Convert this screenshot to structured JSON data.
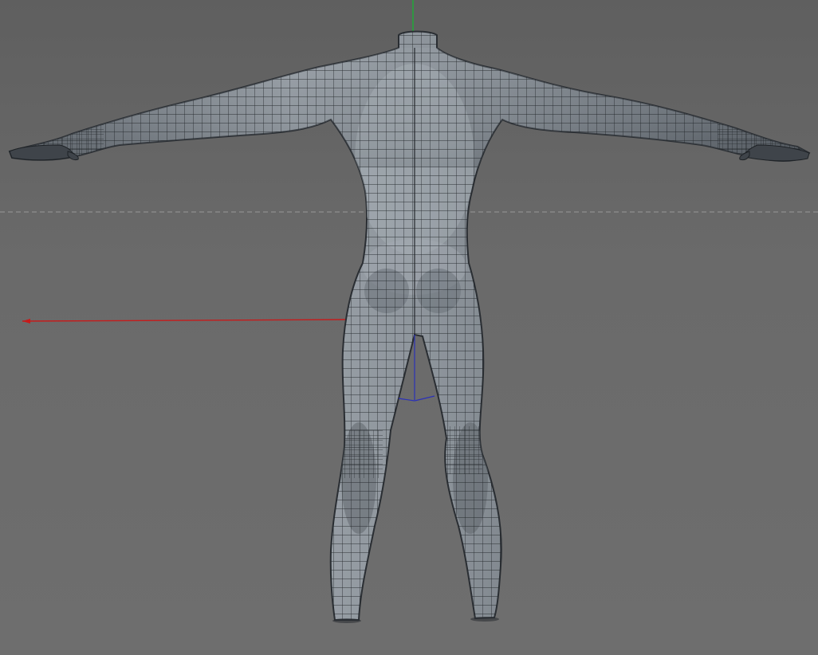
{
  "viewport": {
    "view": "back",
    "model": "human-body-base-mesh",
    "pose": "T-pose",
    "shading": "wireframe-on-shaded",
    "grid_horizon_visible": true
  },
  "axes": {
    "x_color": "#c61b1b",
    "y_color": "#1dae35",
    "z_color": "#2b31b8"
  },
  "colors": {
    "background": "#6a6a6a",
    "mesh_fill": "#8e959c",
    "mesh_shadow": "#3e4349",
    "wire": "#1e2226",
    "horizon_line": "#b9b9b9"
  }
}
